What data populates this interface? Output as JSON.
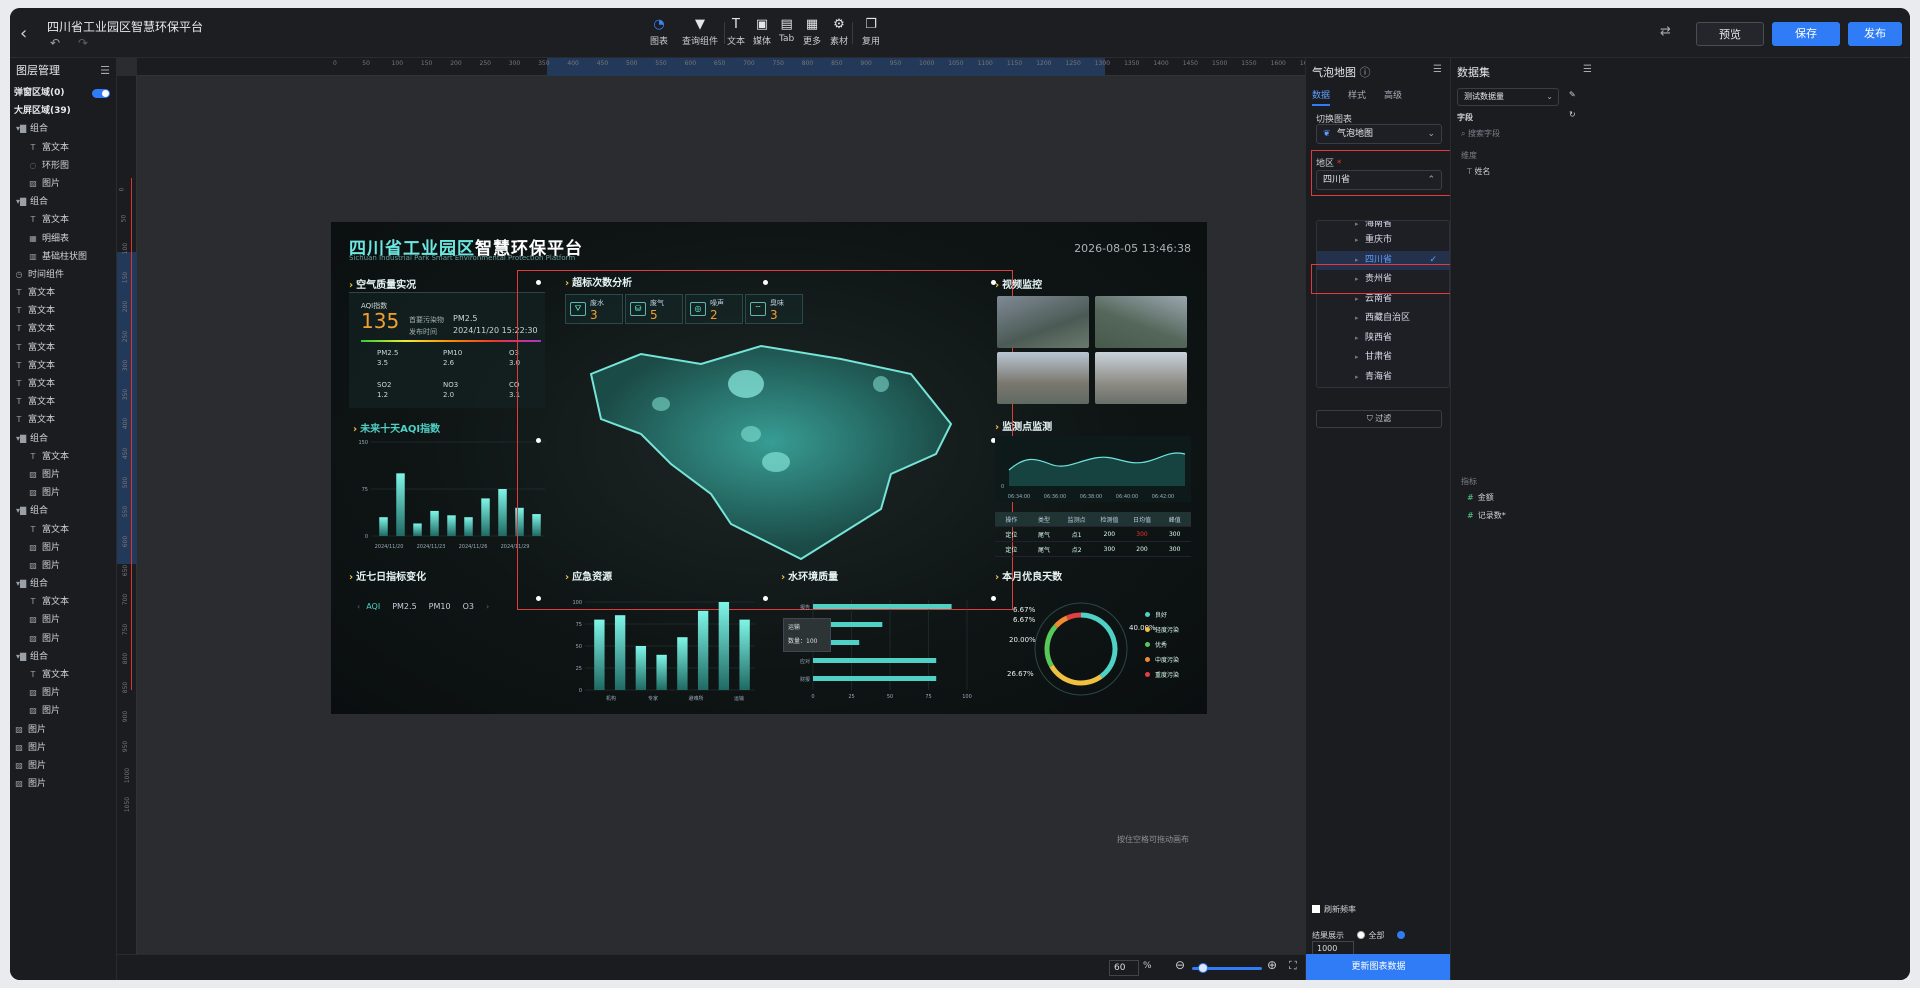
{
  "app": {
    "title": "四川省工业园区智慧环保平台",
    "undo": "↶",
    "redo": "↷"
  },
  "toolbar": {
    "items": [
      {
        "label": "图表",
        "icon": "◔"
      },
      {
        "label": "查询组件",
        "icon": "▼"
      },
      {
        "label": "文本",
        "icon": "T"
      },
      {
        "label": "媒体",
        "icon": "▣"
      },
      {
        "label": "Tab",
        "icon": "▤"
      },
      {
        "label": "更多",
        "icon": "▦"
      },
      {
        "label": "素材",
        "icon": "⚙"
      },
      {
        "label": "复用",
        "icon": "❐"
      }
    ],
    "preview": "预览",
    "save": "保存",
    "publish": "发布"
  },
  "layers": {
    "title": "图层管理",
    "popup": "弹窗区域(0)",
    "big": "大屏区域(39)",
    "items": [
      {
        "i": "▾▇",
        "t": "组合"
      },
      {
        "i": "T",
        "t": "富文本"
      },
      {
        "i": "◌",
        "t": "环形图"
      },
      {
        "i": "▨",
        "t": "图片"
      },
      {
        "i": "▾▇",
        "t": "组合"
      },
      {
        "i": "T",
        "t": "富文本"
      },
      {
        "i": "▦",
        "t": "明细表"
      },
      {
        "i": "▥",
        "t": "基础柱状图"
      },
      {
        "i": "◷",
        "t": "时间组件"
      },
      {
        "i": "T",
        "t": "富文本"
      },
      {
        "i": "T",
        "t": "富文本"
      },
      {
        "i": "T",
        "t": "富文本"
      },
      {
        "i": "T",
        "t": "富文本"
      },
      {
        "i": "T",
        "t": "富文本"
      },
      {
        "i": "T",
        "t": "富文本"
      },
      {
        "i": "T",
        "t": "富文本"
      },
      {
        "i": "T",
        "t": "富文本"
      },
      {
        "i": "▾▇",
        "t": "组合"
      },
      {
        "i": "T",
        "t": "富文本"
      },
      {
        "i": "▨",
        "t": "图片"
      },
      {
        "i": "▨",
        "t": "图片"
      },
      {
        "i": "▾▇",
        "t": "组合"
      },
      {
        "i": "T",
        "t": "富文本"
      },
      {
        "i": "▨",
        "t": "图片"
      },
      {
        "i": "▨",
        "t": "图片"
      },
      {
        "i": "▾▇",
        "t": "组合"
      },
      {
        "i": "T",
        "t": "富文本"
      },
      {
        "i": "▨",
        "t": "图片"
      },
      {
        "i": "▨",
        "t": "图片"
      },
      {
        "i": "▾▇",
        "t": "组合"
      },
      {
        "i": "T",
        "t": "富文本"
      },
      {
        "i": "▨",
        "t": "图片"
      },
      {
        "i": "▨",
        "t": "图片"
      },
      {
        "i": "▨",
        "t": "图片"
      },
      {
        "i": "▨",
        "t": "图片"
      },
      {
        "i": "▨",
        "t": "图片"
      },
      {
        "i": "▨",
        "t": "图片"
      }
    ]
  },
  "ruler": {
    "h": [
      "0",
      "50",
      "100",
      "150",
      "200",
      "250",
      "300",
      "350",
      "400",
      "450",
      "500",
      "550",
      "600",
      "650",
      "700",
      "750",
      "800",
      "850",
      "900",
      "950",
      "1000",
      "1050",
      "1100",
      "1150",
      "1200",
      "1250",
      "1300",
      "1350",
      "1400",
      "1450",
      "1500",
      "1550",
      "1600",
      "1650",
      "1700",
      "1750",
      "1800",
      "1850",
      "1900"
    ],
    "v": [
      "0",
      "50",
      "100",
      "150",
      "200",
      "250",
      "300",
      "350",
      "400",
      "450",
      "500",
      "550",
      "600",
      "650",
      "700",
      "750",
      "800",
      "850",
      "900",
      "950",
      "1000",
      "1050"
    ]
  },
  "canvas": {
    "hint": "按住空格可拖动画布",
    "zoom": "60",
    "pct": "%"
  },
  "dash": {
    "title_a": "四川省工业园区",
    "title_b": "智慧环保平台",
    "subtitle": "Sichuan Industrial Park Smart Environmental Protection Platform",
    "time": "2026-08-05 13:46:38",
    "s_air": "空气质量实况",
    "s_exceed": "超标次数分析",
    "s_video": "视频监控",
    "s_future": "未来十天AQI指数",
    "s_point": "监测点监测",
    "s_seven": "近七日指标变化",
    "s_emerg": "应急资源",
    "s_water": "水环境质量",
    "s_days": "本月优良天数",
    "aqi_label": "AQI指数",
    "aqi": "135",
    "primary_label": "首要污染物",
    "primary": "PM2.5",
    "pub_label": "发布时间",
    "pub": "2024/11/20 15:22:30",
    "pm25_l": "PM2.5",
    "pm25": "3.5",
    "pm10_l": "PM10",
    "pm10": "2.6",
    "o3_l": "O3",
    "o3": "3.0",
    "so2_l": "SO2",
    "so2": "1.2",
    "no3_l": "NO3",
    "no3": "2.0",
    "co_l": "CO",
    "co": "3.1",
    "kpi": [
      {
        "n": "废水",
        "v": "3"
      },
      {
        "n": "废气",
        "v": "5"
      },
      {
        "n": "噪声",
        "v": "2"
      },
      {
        "n": "臭味",
        "v": "3"
      }
    ],
    "future_y": [
      "150",
      "75",
      "0"
    ],
    "future_x": [
      "2024/11/20",
      "2024/11/23",
      "2024/11/26",
      "2024/11/29"
    ],
    "point_x": [
      "06:34:00",
      "06:36:00",
      "06:38:00",
      "06:40:00",
      "06:42:00"
    ],
    "point_y0": "0",
    "tbl_head": [
      "操作",
      "类型",
      "监测点",
      "检测值",
      "日均值",
      "峰值"
    ],
    "tbl_rows": [
      [
        "定位",
        "尾气",
        "点1",
        "200",
        "300",
        "300"
      ],
      [
        "定位",
        "尾气",
        "点2",
        "300",
        "200",
        "300"
      ]
    ],
    "tabs": [
      "AQI",
      "PM2.5",
      "PM10",
      "O3"
    ],
    "emerg_y": [
      "100",
      "75",
      "50",
      "25",
      "0"
    ],
    "emerg_x": [
      "机构",
      "专家",
      "避难所",
      "运输"
    ],
    "water_rows": [
      "报告",
      "",
      "运输",
      "应对",
      "财报"
    ],
    "water_x": [
      "0",
      "25",
      "50",
      "75",
      "100"
    ],
    "tooltip_t": "运输",
    "tooltip_v": "数量：100",
    "donut": [
      "6.67%",
      "6.67%",
      "20.00%",
      "26.67%",
      "40.00%"
    ],
    "legend": [
      {
        "n": "良好",
        "c": "#4fd1c5"
      },
      {
        "n": "轻度污染",
        "c": "#f0c040"
      },
      {
        "n": "优秀",
        "c": "#58c85a"
      },
      {
        "n": "中度污染",
        "c": "#f08a30"
      },
      {
        "n": "重度污染",
        "c": "#e24040"
      }
    ]
  },
  "chart_data": [
    {
      "type": "bar",
      "title": "未来十天AQI指数",
      "categories": [
        "2024/11/20",
        "",
        "",
        "2024/11/23",
        "",
        "",
        "2024/11/26",
        "",
        "",
        "2024/11/29"
      ],
      "values": [
        30,
        100,
        20,
        40,
        33,
        30,
        60,
        75,
        45,
        35
      ],
      "ylim": [
        0,
        150
      ]
    },
    {
      "type": "bar",
      "title": "应急资源",
      "categories": [
        "机构",
        "",
        "专家",
        "",
        "避难所",
        "",
        "运输",
        ""
      ],
      "values": [
        80,
        85,
        50,
        40,
        60,
        90,
        100,
        80
      ],
      "ylim": [
        0,
        100
      ]
    },
    {
      "type": "bar",
      "title": "水环境质量",
      "categories": [
        "报告",
        "",
        "运输",
        "应对",
        "财报"
      ],
      "values": [
        90,
        45,
        30,
        80,
        80
      ],
      "xlim": [
        0,
        100
      ]
    },
    {
      "type": "pie",
      "title": "本月优良天数",
      "categories": [
        "良好",
        "轻度污染",
        "优秀",
        "中度污染",
        "重度污染"
      ],
      "values": [
        40,
        26.67,
        20,
        6.67,
        6.67
      ]
    }
  ],
  "panel": {
    "title": "气泡地图",
    "info": "ⓘ",
    "tabs": [
      "数据",
      "样式",
      "高级"
    ],
    "switch_label": "切换图表",
    "chart_sel": "气泡地图",
    "region_label": "地区",
    "required": "*",
    "region_val": "四川省",
    "options": [
      "海南省",
      "重庆市",
      "四川省",
      "贵州省",
      "云南省",
      "西藏自治区",
      "陕西省",
      "甘肃省",
      "青海省"
    ],
    "selected": "四川省",
    "filter": "过滤",
    "refresh": "刷新频率",
    "result": "结果展示",
    "all": "全部",
    "count": "1000",
    "update": "更新图表数据"
  },
  "dataset": {
    "title": "数据集",
    "sel": "测试数据量",
    "field": "字段",
    "search_ph": "搜索字段",
    "dim": "维度",
    "dim_item": "姓名",
    "metric": "指标",
    "m1": "金额",
    "m2": "记录数*"
  }
}
